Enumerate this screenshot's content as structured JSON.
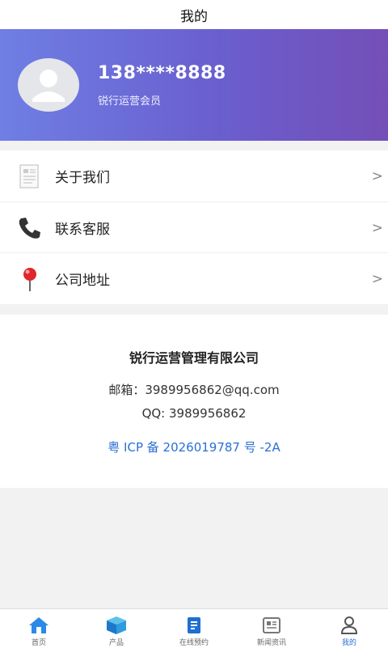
{
  "page": {
    "title": "我的"
  },
  "profile": {
    "phone": "138****8888",
    "member_label": "锐行运营会员"
  },
  "menu": {
    "items": [
      {
        "label": "关于我们",
        "icon": "document-icon",
        "arrow": ">"
      },
      {
        "label": "联系客服",
        "icon": "phone-icon",
        "arrow": ">"
      },
      {
        "label": "公司地址",
        "icon": "location-pin-icon",
        "arrow": ">"
      }
    ]
  },
  "company": {
    "name": "锐行运营管理有限公司",
    "email": "邮箱：3989956862@qq.com",
    "qq": "QQ: 3989956862",
    "icp": "粤 ICP 备 2026019787 号 -2A"
  },
  "tabbar": {
    "items": [
      {
        "label": "首页",
        "icon": "home-icon"
      },
      {
        "label": "产品",
        "icon": "box-icon"
      },
      {
        "label": "在线预约",
        "icon": "booking-icon"
      },
      {
        "label": "新闻资讯",
        "icon": "news-icon"
      },
      {
        "label": "我的",
        "icon": "user-icon",
        "active": true
      }
    ]
  },
  "colors": {
    "header_start": "#6f7fe4",
    "header_end": "#744fb7",
    "accent": "#2a6fd6"
  }
}
